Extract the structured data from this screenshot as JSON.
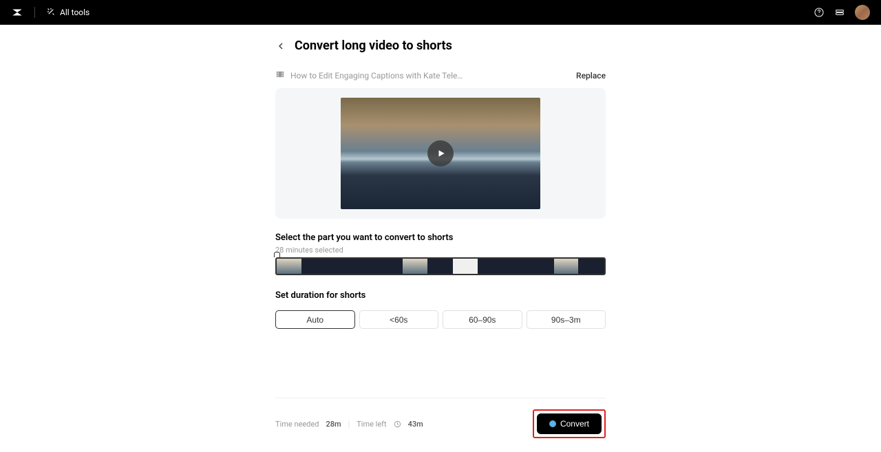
{
  "header": {
    "all_tools_label": "All tools"
  },
  "page": {
    "title": "Convert long video to shorts",
    "video_filename": "How to Edit Engaging Captions with Kate Tele…",
    "replace_label": "Replace",
    "select_part_label": "Select the part you want to convert to shorts",
    "duration_selected": "28 minutes selected",
    "set_duration_label": "Set duration for shorts",
    "duration_options": [
      "Auto",
      "<60s",
      "60–90s",
      "90s–3m"
    ]
  },
  "footer": {
    "time_needed_label": "Time needed",
    "time_needed_value": "28m",
    "time_left_label": "Time left",
    "time_left_value": "43m",
    "convert_label": "Convert"
  }
}
